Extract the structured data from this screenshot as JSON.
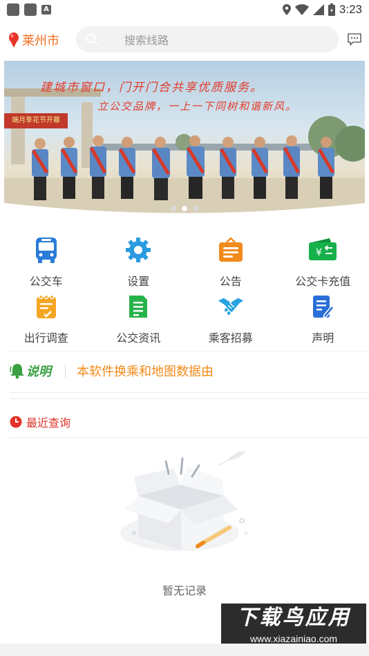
{
  "status_bar": {
    "time": "3:23"
  },
  "header": {
    "city": "莱州市",
    "search_placeholder": "搜索线路"
  },
  "banner": {
    "line1": "建城市窗口，门开门合共享优质服务。",
    "line2": "立公交品牌，一上一下同树和谐新风。",
    "sign": "端月季花节开幕",
    "slide_count": 3,
    "active_slide": 2
  },
  "grid": [
    {
      "label": "公交车",
      "icon": "bus-icon",
      "color": "#2a7bd8"
    },
    {
      "label": "设置",
      "icon": "gear-icon",
      "color": "#2a9be0"
    },
    {
      "label": "公告",
      "icon": "announcement-icon",
      "color": "#f08a1c"
    },
    {
      "label": "公交卡充值",
      "icon": "wallet-icon",
      "color": "#16b14a"
    },
    {
      "label": "出行调查",
      "icon": "survey-icon",
      "color": "#f5a623"
    },
    {
      "label": "公交资讯",
      "icon": "news-icon",
      "color": "#27b34a"
    },
    {
      "label": "乘客招募",
      "icon": "handshake-icon",
      "color": "#29a3e0"
    },
    {
      "label": "声明",
      "icon": "statement-icon",
      "color": "#2a6fd8"
    }
  ],
  "notice": {
    "brand": "说明",
    "text": "本软件换乘和地图数据由"
  },
  "recent": {
    "title": "最近查询",
    "empty_text": "暂无记录"
  },
  "watermark": {
    "main": "下载鸟应用",
    "sub": "www.xiazainiao.com"
  },
  "colors": {
    "accent": "#f26b1d",
    "notice_text": "#f28a1a",
    "recent_title": "#e0322a"
  }
}
